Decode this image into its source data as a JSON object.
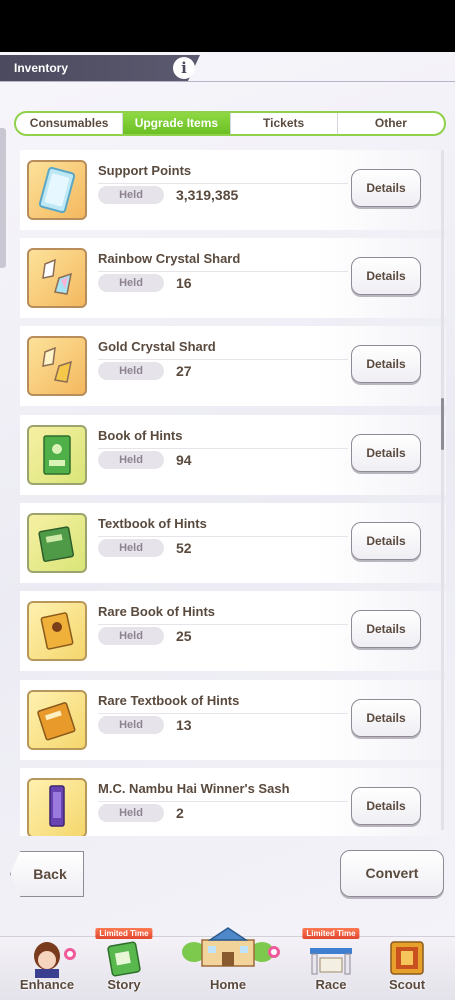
{
  "header": {
    "title": "Inventory",
    "info_glyph": "i"
  },
  "tabs": [
    {
      "label": "Consumables",
      "active": false
    },
    {
      "label": "Upgrade Items",
      "active": true
    },
    {
      "label": "Tickets",
      "active": false
    },
    {
      "label": "Other",
      "active": false
    }
  ],
  "held_label": "Held",
  "details_label": "Details",
  "items": [
    {
      "name": "Support Points",
      "held": "3,319,385",
      "icon": "support-points-icon"
    },
    {
      "name": "Rainbow Crystal Shard",
      "held": "16",
      "icon": "rainbow-crystal-shard-icon"
    },
    {
      "name": "Gold Crystal Shard",
      "held": "27",
      "icon": "gold-crystal-shard-icon"
    },
    {
      "name": "Book of Hints",
      "held": "94",
      "icon": "book-of-hints-icon"
    },
    {
      "name": "Textbook of Hints",
      "held": "52",
      "icon": "textbook-of-hints-icon"
    },
    {
      "name": "Rare Book of Hints",
      "held": "25",
      "icon": "rare-book-of-hints-icon"
    },
    {
      "name": "Rare Textbook of Hints",
      "held": "13",
      "icon": "rare-textbook-of-hints-icon"
    },
    {
      "name": "M.C. Nambu Hai Winner's Sash",
      "held": "2",
      "icon": "winners-sash-icon"
    }
  ],
  "footer": {
    "back_label": "Back",
    "convert_label": "Convert"
  },
  "bottom_nav": {
    "limited_time": "Limited Time",
    "items": [
      {
        "label": "Enhance",
        "icon": "enhance-icon"
      },
      {
        "label": "Story",
        "icon": "story-icon"
      },
      {
        "label": "Home",
        "icon": "home-icon"
      },
      {
        "label": "Race",
        "icon": "race-icon"
      },
      {
        "label": "Scout",
        "icon": "scout-icon"
      }
    ]
  },
  "colors": {
    "accent_green": "#7ccb30",
    "text_brown": "#5a4a3e",
    "title_bar": "#4b4a5e",
    "notify_pink": "#ef5a9a"
  }
}
